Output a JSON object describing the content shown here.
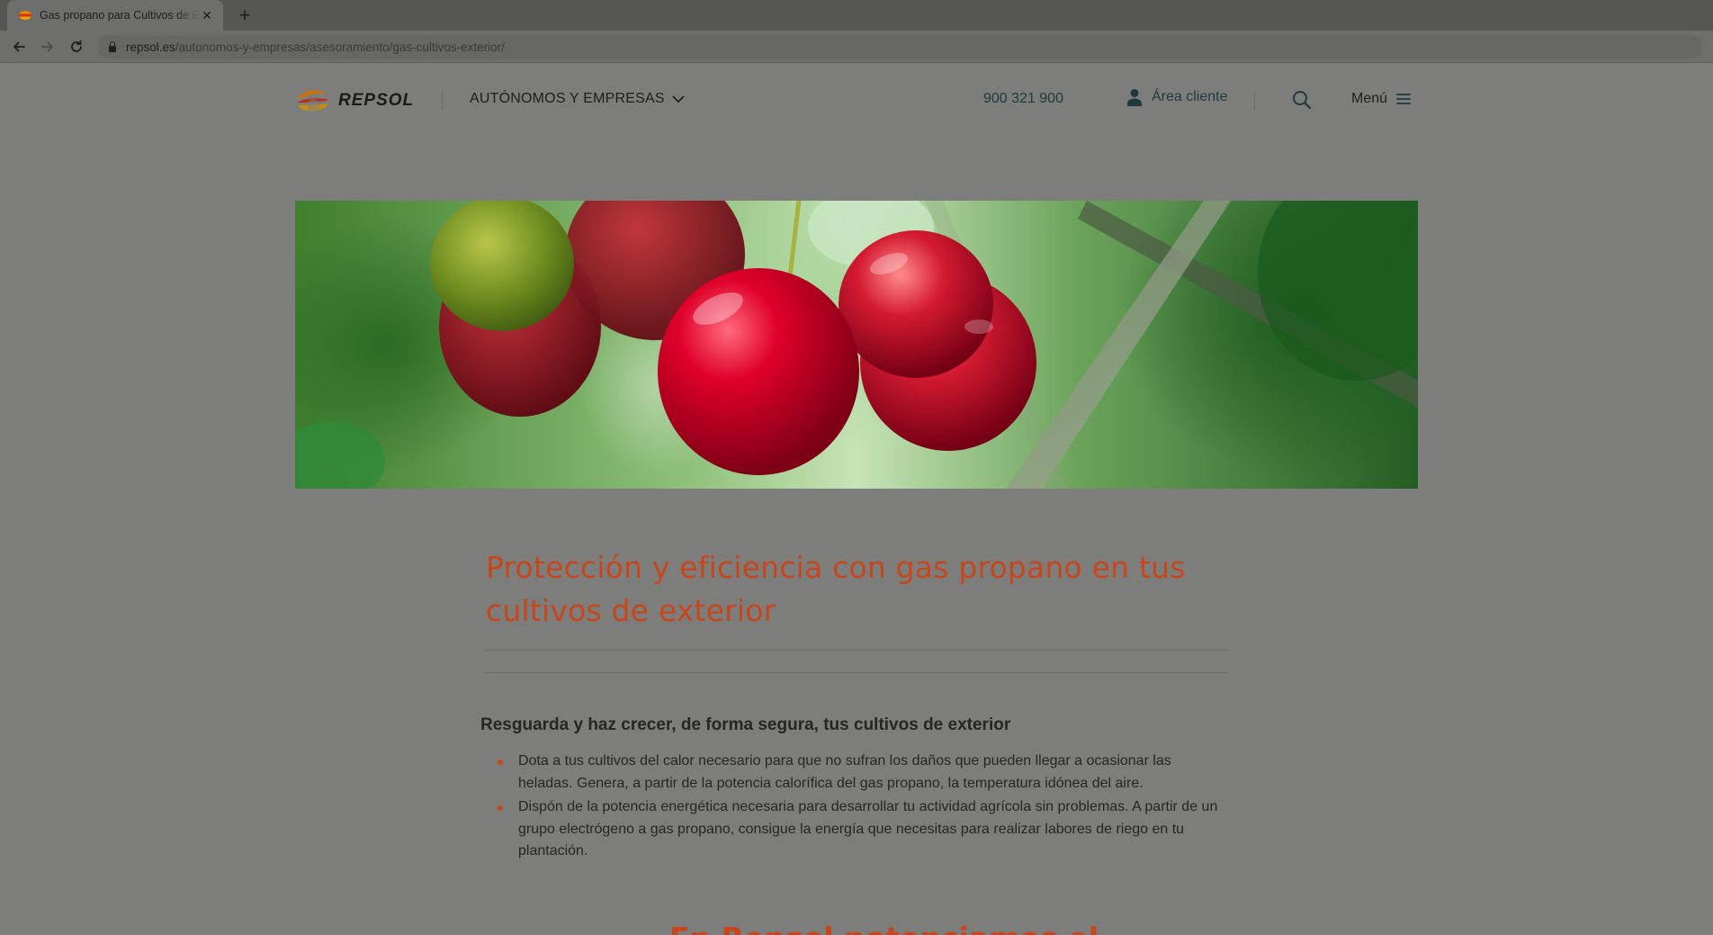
{
  "browser": {
    "tab_title": "Gas propano para Cultivos de Exterior",
    "new_tab_label": "+",
    "url_domain": "repsol.es",
    "url_path": "/autonomos-y-empresas/asesoramiento/gas-cultivos-exterior/"
  },
  "header": {
    "logo_text": "REPSOL",
    "business_menu_label": "AUTÓNOMOS Y EMPRESAS",
    "phone": "900 321 900",
    "client_area_label": "Área cliente",
    "menu_label": "Menú"
  },
  "article": {
    "title": "Protección y eficiencia con gas propano en tus cultivos de exterior",
    "subheading": "Resguarda y haz crecer, de forma segura, tus cultivos de exterior",
    "benefits": [
      "Dota a tus cultivos del calor necesario para que no sufran los daños que pueden llegar a ocasionar las heladas. Genera, a partir de la potencia calorífica del gas propano, la temperatura idónea del aire.",
      "Dispón de la potencia energética necesaria para desarrollar tu actividad agrícola sin problemas. A partir de un grupo electrógeno a gas propano, consigue la energía que necesitas para realizar labores de riego en tu plantación."
    ],
    "next_heading": "En Repsol potenciamos el"
  },
  "colors": {
    "accent": "#c8461c",
    "overlay_background": "#7d7d7b"
  }
}
